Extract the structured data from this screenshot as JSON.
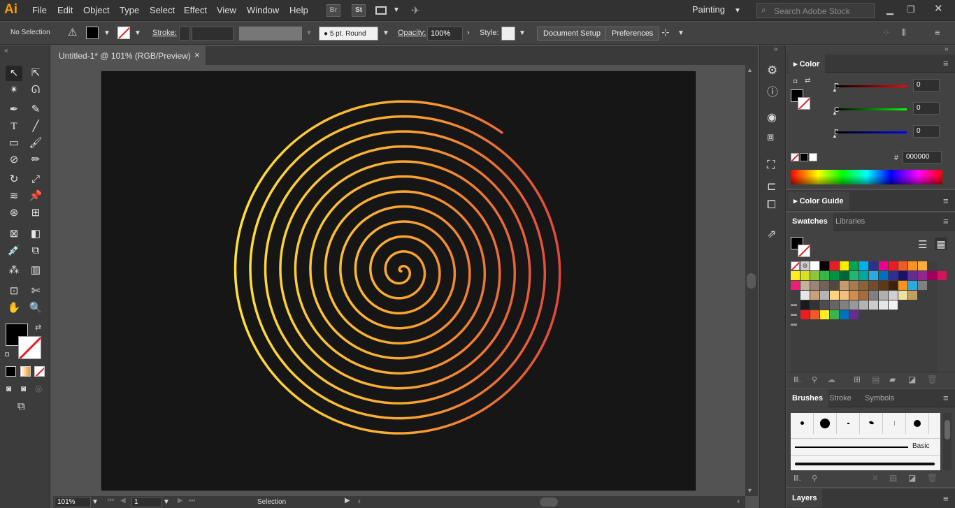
{
  "app": {
    "logo": "Ai"
  },
  "menu": [
    "File",
    "Edit",
    "Object",
    "Type",
    "Select",
    "Effect",
    "View",
    "Window",
    "Help"
  ],
  "menubar_icons": {
    "bridge": "Br",
    "stock": "St"
  },
  "workspace": "Painting",
  "search": {
    "placeholder": "Search Adobe Stock"
  },
  "control": {
    "selection": "No Selection",
    "stroke_label": "Stroke:",
    "brush": "5 pt. Round",
    "opacity_label": "Opacity:",
    "opacity": "100%",
    "style_label": "Style:",
    "document_setup": "Document Setup",
    "preferences": "Preferences"
  },
  "document": {
    "tab": "Untitled-1* @ 101% (RGB/Preview)",
    "close": "×"
  },
  "status": {
    "zoom": "101%",
    "page": "1",
    "tool": "Selection"
  },
  "color_panel": {
    "title": "Color",
    "r_label": "R",
    "r": "0",
    "g_label": "G",
    "g": "0",
    "b_label": "B",
    "b": "0",
    "hash": "#",
    "hex": "000000"
  },
  "color_guide": {
    "title": "Color Guide"
  },
  "swatches_tabs": [
    "Swatches",
    "Libraries"
  ],
  "brushes_tabs": [
    "Brushes",
    "Stroke",
    "Symbols"
  ],
  "brushes": {
    "basic": "Basic"
  },
  "layers": {
    "title": "Layers"
  },
  "colors": {
    "spiral_start": "#ffe23a",
    "spiral_mid": "#f9a030",
    "spiral_end": "#e2473c",
    "ui_dark": "#323232",
    "artboard": "#161616"
  },
  "swatch_rows": [
    [
      "#ffffff",
      "#000000",
      "#e31e25",
      "#ffed00",
      "#00a651",
      "#00aeef",
      "#2e3192",
      "#ec008c",
      "#ed1c24",
      "#f15a24",
      "#f7931e",
      "#fbb03b"
    ],
    [
      "#fcee21",
      "#d9e021",
      "#8cc63f",
      "#39b54a",
      "#009245",
      "#006837",
      "#22b573",
      "#00a99d",
      "#29abe2",
      "#0071bc",
      "#2e3192",
      "#1b1464",
      "#662d91",
      "#93278f",
      "#9e005d",
      "#d4145a"
    ],
    [
      "#ed1e79",
      "#c7b299",
      "#998675",
      "#736357",
      "#534741",
      "#c69c6d",
      "#a67c52",
      "#8c6239",
      "#754c24",
      "#603813",
      "#42210b",
      "#f7931e",
      "#29abe2",
      "#808080"
    ],
    [
      "#e6e6e6",
      "#c8a07a",
      "#b5b5b5",
      "#ffd27f",
      "#f0c080",
      "#d48c50",
      "#a86c3c",
      "#808080",
      "#b0b0b0",
      "#d0d0d0",
      "#f0e0a0",
      "#c0a060"
    ],
    [
      "#1a1a1a",
      "#333333",
      "#4d4d4d",
      "#666666",
      "#808080",
      "#999999",
      "#b3b3b3",
      "#cccccc",
      "#e6e6e6",
      "#f2f2f2"
    ],
    [
      "#ed1c24",
      "#f15a24",
      "#fcee21",
      "#39b54a",
      "#0071bc",
      "#662d91"
    ]
  ]
}
